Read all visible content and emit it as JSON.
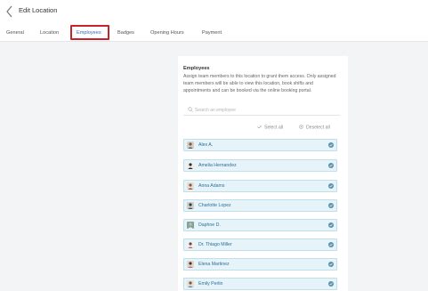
{
  "header": {
    "title": "Edit Location"
  },
  "tabs": [
    {
      "label": "General"
    },
    {
      "label": "Location"
    },
    {
      "label": "Employees",
      "active": true
    },
    {
      "label": "Badges"
    },
    {
      "label": "Opening Hours"
    },
    {
      "label": "Payment"
    }
  ],
  "employees_section": {
    "title": "Employees",
    "description": "Assign team members to this location to grant them access. Only assigned team members will be able to view this location, book shifts and appointments and can be booked via the online booking portal.",
    "search_placeholder": "Search an employee",
    "select_all": "Select all",
    "deselect_all": "Deselect all",
    "employees": [
      {
        "name": "Alex A.",
        "selected": true
      },
      {
        "name": "Amelia Hernandez",
        "selected": true
      },
      {
        "name": "Anna Adams",
        "selected": true
      },
      {
        "name": "Charlotte Lopez",
        "selected": true
      },
      {
        "name": "Daphne D.",
        "selected": true
      },
      {
        "name": "Dr. Thiago Miller",
        "selected": true
      },
      {
        "name": "Elena Martinez",
        "selected": true
      },
      {
        "name": "Emily Perlin",
        "selected": true
      }
    ]
  },
  "colors": {
    "accent": "#2f6fb6",
    "highlight": "#c7232b",
    "row_bg": "#e6f3f8",
    "check": "#5b93ad"
  }
}
